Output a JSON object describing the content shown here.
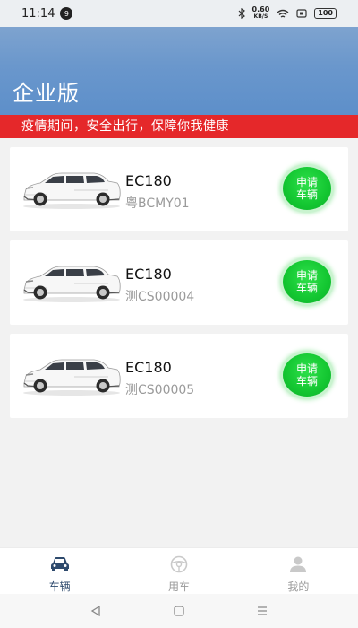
{
  "status_bar": {
    "time": "11:14",
    "notification_count": "9",
    "net_speed_value": "0.60",
    "net_speed_unit": "KB/S",
    "battery": "100"
  },
  "header": {
    "title": "企业版"
  },
  "notice": {
    "text": "疫情期间，安全出行，保障你我健康"
  },
  "vehicles": [
    {
      "model": "EC180",
      "plate": "粤BCMY01",
      "apply_label": "申请车辆"
    },
    {
      "model": "EC180",
      "plate": "测CS00004",
      "apply_label": "申请车辆"
    },
    {
      "model": "EC180",
      "plate": "测CS00005",
      "apply_label": "申请车辆"
    }
  ],
  "tabs": [
    {
      "label": "车辆",
      "icon": "car-icon",
      "active": true
    },
    {
      "label": "用车",
      "icon": "steering-wheel-icon",
      "active": false
    },
    {
      "label": "我的",
      "icon": "person-icon",
      "active": false
    }
  ],
  "colors": {
    "header": "#6a97cc",
    "notice": "#e5282a",
    "apply_button": "#13c631",
    "tab_active": "#2e4a6d",
    "tab_inactive": "#9a9a9a"
  }
}
